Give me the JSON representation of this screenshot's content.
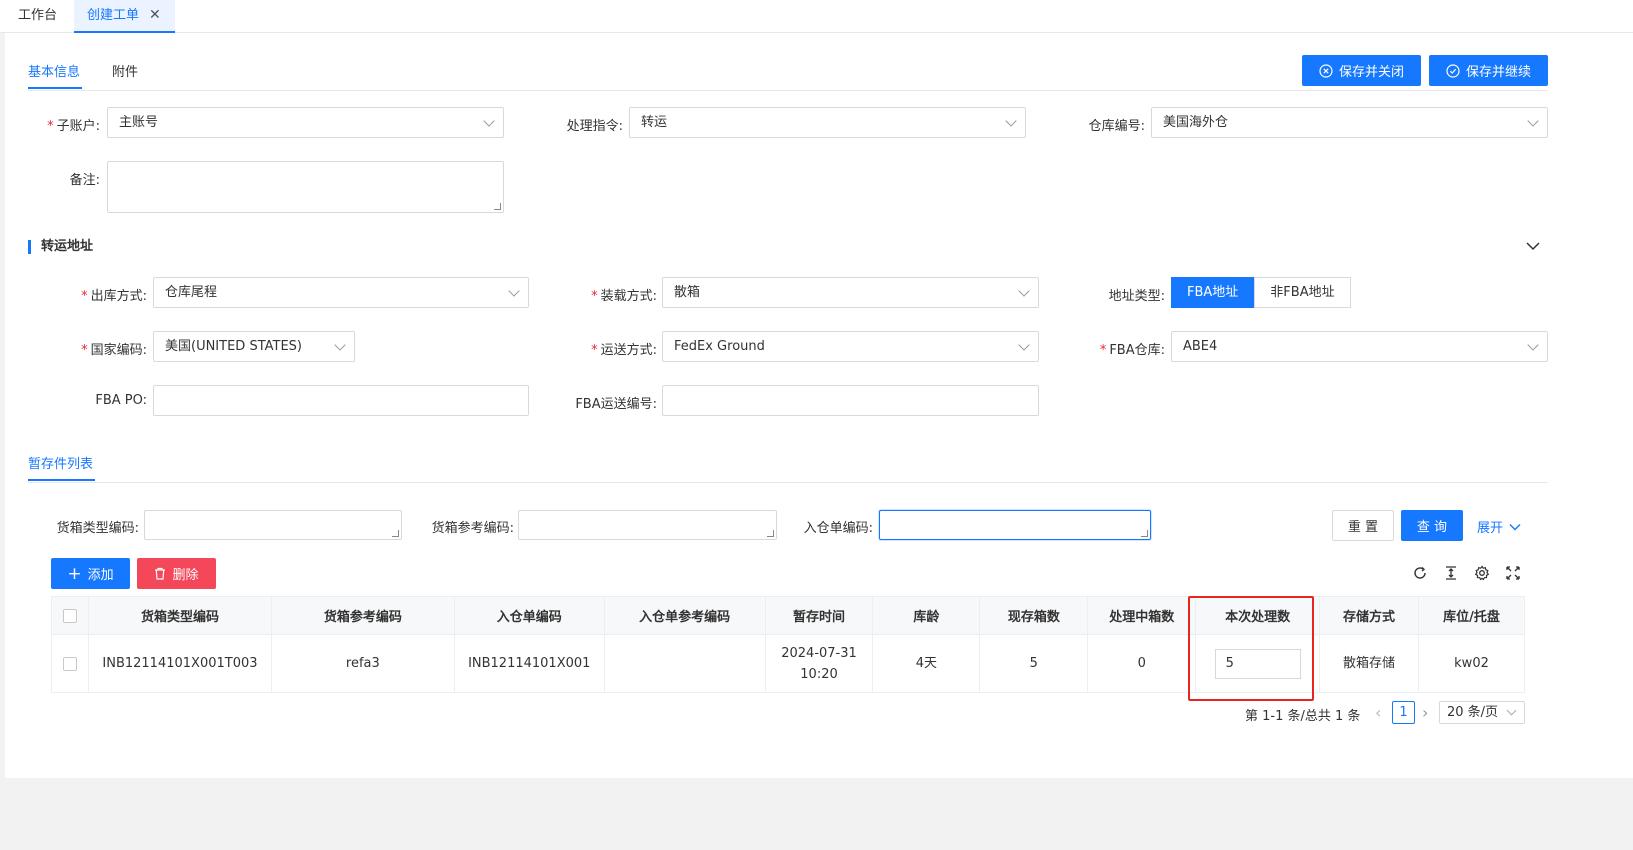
{
  "tabs": {
    "workbench": "工作台",
    "create_order": "创建工单",
    "close": "✕"
  },
  "subtabs": {
    "basic": "基本信息",
    "attachment": "附件"
  },
  "buttons": {
    "save_close": "保存并关闭",
    "save_continue": "保存并继续",
    "reset": "重 置",
    "query": "查 询",
    "expand": "展开",
    "add": "添加",
    "delete": "删除"
  },
  "form": {
    "sub_account": {
      "label": "子账户:",
      "value": "主账号"
    },
    "instruction": {
      "label": "处理指令:",
      "value": "转运"
    },
    "warehouse": {
      "label": "仓库编号:",
      "value": "美国海外仓"
    },
    "remark": {
      "label": "备注:",
      "value": ""
    }
  },
  "transfer": {
    "title": "转运地址",
    "outbound": {
      "label": "出库方式:",
      "value": "仓库尾程"
    },
    "loading": {
      "label": "装载方式:",
      "value": "散箱"
    },
    "address_type": {
      "label": "地址类型:",
      "options": [
        "FBA地址",
        "非FBA地址"
      ]
    },
    "country": {
      "label": "国家编码:",
      "value": "美国(UNITED STATES)"
    },
    "shipping": {
      "label": "运送方式:",
      "value": "FedEx Ground"
    },
    "fba_warehouse": {
      "label": "FBA仓库:",
      "value": "ABE4"
    },
    "fba_po": {
      "label": "FBA PO:",
      "value": ""
    },
    "fba_ship_no": {
      "label": "FBA运送编号:",
      "value": ""
    }
  },
  "list": {
    "tab": "暂存件列表",
    "filters": {
      "box_type": "货箱类型编码:",
      "box_ref": "货箱参考编码:",
      "inbound": "入仓单编码:"
    },
    "columns": [
      "货箱类型编码",
      "货箱参考编码",
      "入仓单编码",
      "入仓单参考编码",
      "暂存时间",
      "库龄",
      "现存箱数",
      "处理中箱数",
      "本次处理数",
      "存储方式",
      "库位/托盘"
    ],
    "rows": [
      {
        "box_type": "INB12114101X001T003",
        "box_ref": "refa3",
        "inbound": "INB12114101X001",
        "inbound_ref": "",
        "time_date": "2024-07-31",
        "time_clock": "10:20",
        "age": "4天",
        "stock": "5",
        "processing": "0",
        "this_qty": "5",
        "storage": "散箱存储",
        "location": "kw02"
      }
    ]
  },
  "pager": {
    "summary": "第 1-1 条/总共 1 条",
    "page": "1",
    "page_size": "20 条/页",
    "prev": "‹",
    "next": "›"
  }
}
